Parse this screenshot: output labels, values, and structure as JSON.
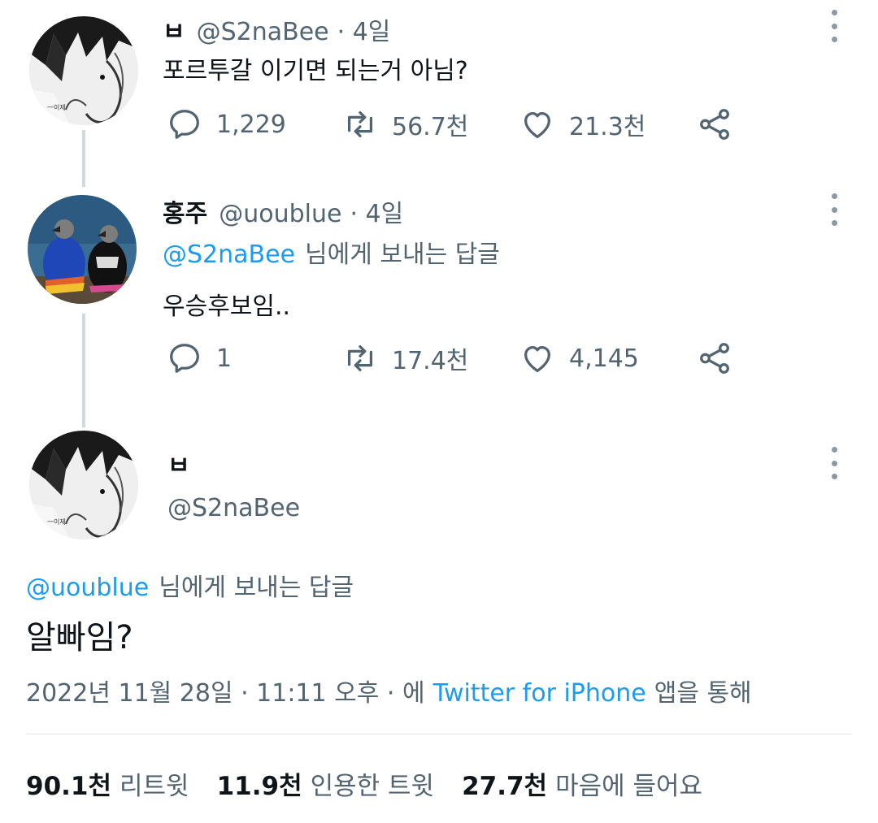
{
  "tweet1": {
    "name": "ㅂ",
    "handle": "@S2naBee",
    "time": "· 4일",
    "text": "포르투갈 이기면 되는거 아님?",
    "replies": "1,229",
    "retweets": "56.7천",
    "likes": "21.3천"
  },
  "tweet2": {
    "name": "홍주",
    "handle": "@uoublue",
    "time": "· 4일",
    "reply_to_handle": "@S2naBee",
    "reply_to_suffix": "님에게 보내는 답글",
    "text": "우승후보임..",
    "replies": "1",
    "retweets": "17.4천",
    "likes": "4,145"
  },
  "tweet3": {
    "name": "ㅂ",
    "handle": "@S2naBee",
    "reply_to_handle": "@uoublue",
    "reply_to_suffix": "님에게 보내는 답글",
    "text": "알빠임?",
    "meta_date": "2022년 11월 28일 · 11:11 오후 · 에",
    "meta_source": "Twitter for iPhone",
    "meta_suffix": "앱을 통해"
  },
  "stats": {
    "retweets_num": "90.1천",
    "retweets_label": "리트윗",
    "quotes_num": "11.9천",
    "quotes_label": "인용한 트윗",
    "likes_num": "27.7천",
    "likes_label": "마음에 들어요"
  },
  "avatar_text": "一이제",
  "colors": {
    "accent": "#1d9bf0",
    "secondary_text": "#536471",
    "thread_line": "#cfd9de"
  },
  "icons": [
    "reply-icon",
    "retweet-icon",
    "like-icon",
    "share-icon",
    "more-icon"
  ]
}
